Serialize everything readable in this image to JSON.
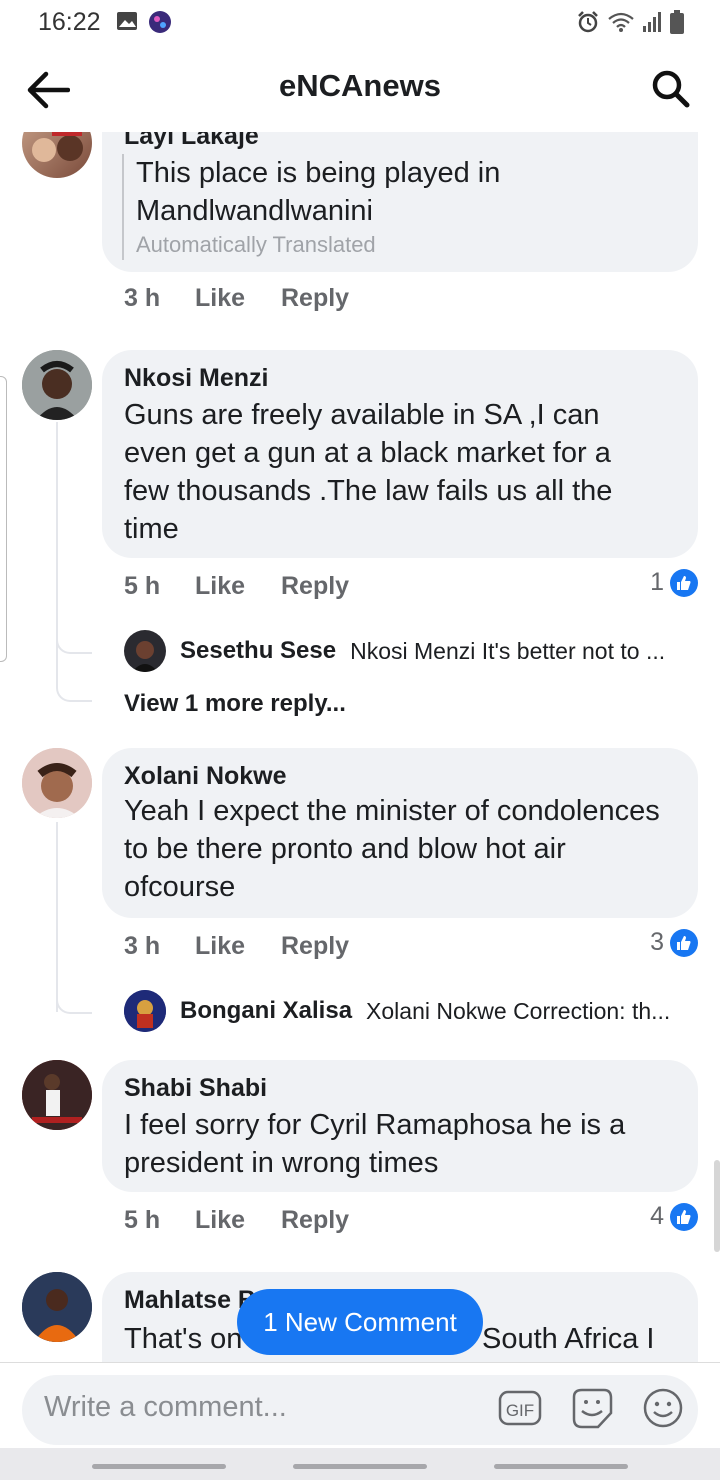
{
  "status": {
    "time": "16:22"
  },
  "header": {
    "title": "eNCAnews"
  },
  "comments": [
    {
      "author": "Layi Lakaje",
      "text_line1": "This place is being played in",
      "text_line2": "Mandlwandlwanini",
      "translated": "Automatically Translated",
      "time": "3 h",
      "like": "Like",
      "reply": "Reply"
    },
    {
      "author": "Nkosi Menzi",
      "text": "Guns are freely available in SA ,I can even get a gun at a black market for a few thousands .The law fails us all the time",
      "time": "5 h",
      "like": "Like",
      "reply": "Reply",
      "likes": "1",
      "reply_preview": {
        "author": "Sesethu Sese",
        "text": "Nkosi Menzi It's better not to ..."
      },
      "view_more": "View 1 more reply..."
    },
    {
      "author": "Xolani Nokwe",
      "text": "Yeah I expect the minister of condolences to be there pronto and blow hot air ofcourse",
      "time": "3 h",
      "like": "Like",
      "reply": "Reply",
      "likes": "3",
      "reply_preview": {
        "author": "Bongani Xalisa",
        "text": "Xolani Nokwe Correction: th..."
      }
    },
    {
      "author": "Shabi Shabi",
      "text": "I feel sorry for Cyril Ramaphosa he is a president in wrong times",
      "time": "5 h",
      "like": "Like",
      "reply": "Reply",
      "likes": "4"
    },
    {
      "author": "Mahlatse B",
      "text_left": "That's on",
      "text_right": "South Africa I"
    }
  ],
  "new_comment_button": "1 New Comment",
  "composer": {
    "placeholder": "Write a comment...",
    "gif_label": "GIF"
  },
  "colors": {
    "accent": "#1877f2",
    "bubble": "#f0f2f5",
    "meta": "#65676b"
  },
  "icons": [
    "gallery-icon",
    "app-icon",
    "alarm-icon",
    "wifi-icon",
    "signal-icon",
    "battery-icon",
    "back-arrow-icon",
    "search-icon",
    "like-thumb-icon",
    "gif-icon",
    "sticker-icon",
    "emoji-icon"
  ]
}
